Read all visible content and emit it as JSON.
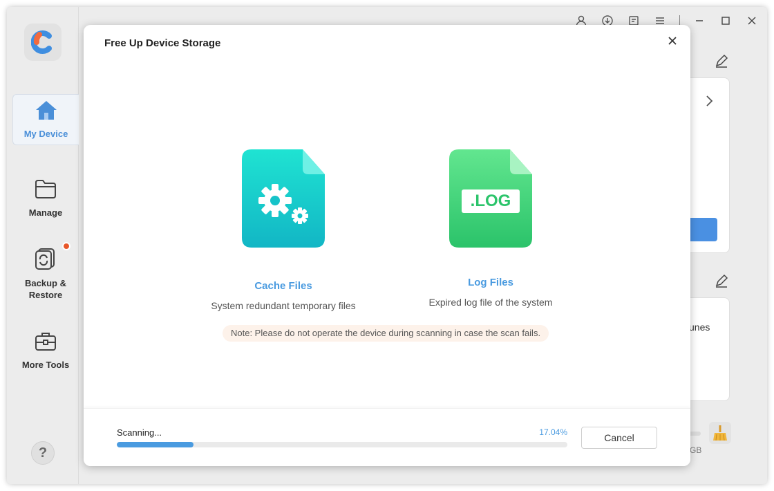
{
  "sidebar": {
    "items": [
      {
        "label": "My Device",
        "icon": "home-icon",
        "active": true
      },
      {
        "label": "Manage",
        "icon": "folder-icon"
      },
      {
        "label": "Backup & Restore",
        "icon": "backup-restore-icon",
        "badge": true
      },
      {
        "label": "More Tools",
        "icon": "toolbox-icon"
      }
    ],
    "help_label": "?"
  },
  "background": {
    "card_text": "unes",
    "storage_text": "GB"
  },
  "modal": {
    "title": "Free Up Device Storage",
    "cards": [
      {
        "name": "Cache Files",
        "description": "System redundant temporary files",
        "icon": "cache-file-icon"
      },
      {
        "name": "Log Files",
        "description": "Expired log file of the system",
        "icon": "log-file-icon",
        "icon_text": ".LOG"
      }
    ],
    "note": "Note: Please do not operate the device during scanning in case the scan fails.",
    "scan": {
      "label": "Scanning...",
      "percent_text": "17.04%",
      "progress": 0.1704
    },
    "cancel_label": "Cancel"
  },
  "colors": {
    "accent": "#4a9be0",
    "cache_gradient": [
      "#20e0d0",
      "#12b8c4"
    ],
    "log_gradient": [
      "#5ee58c",
      "#2cc46b"
    ],
    "badge": "#e8572a"
  }
}
